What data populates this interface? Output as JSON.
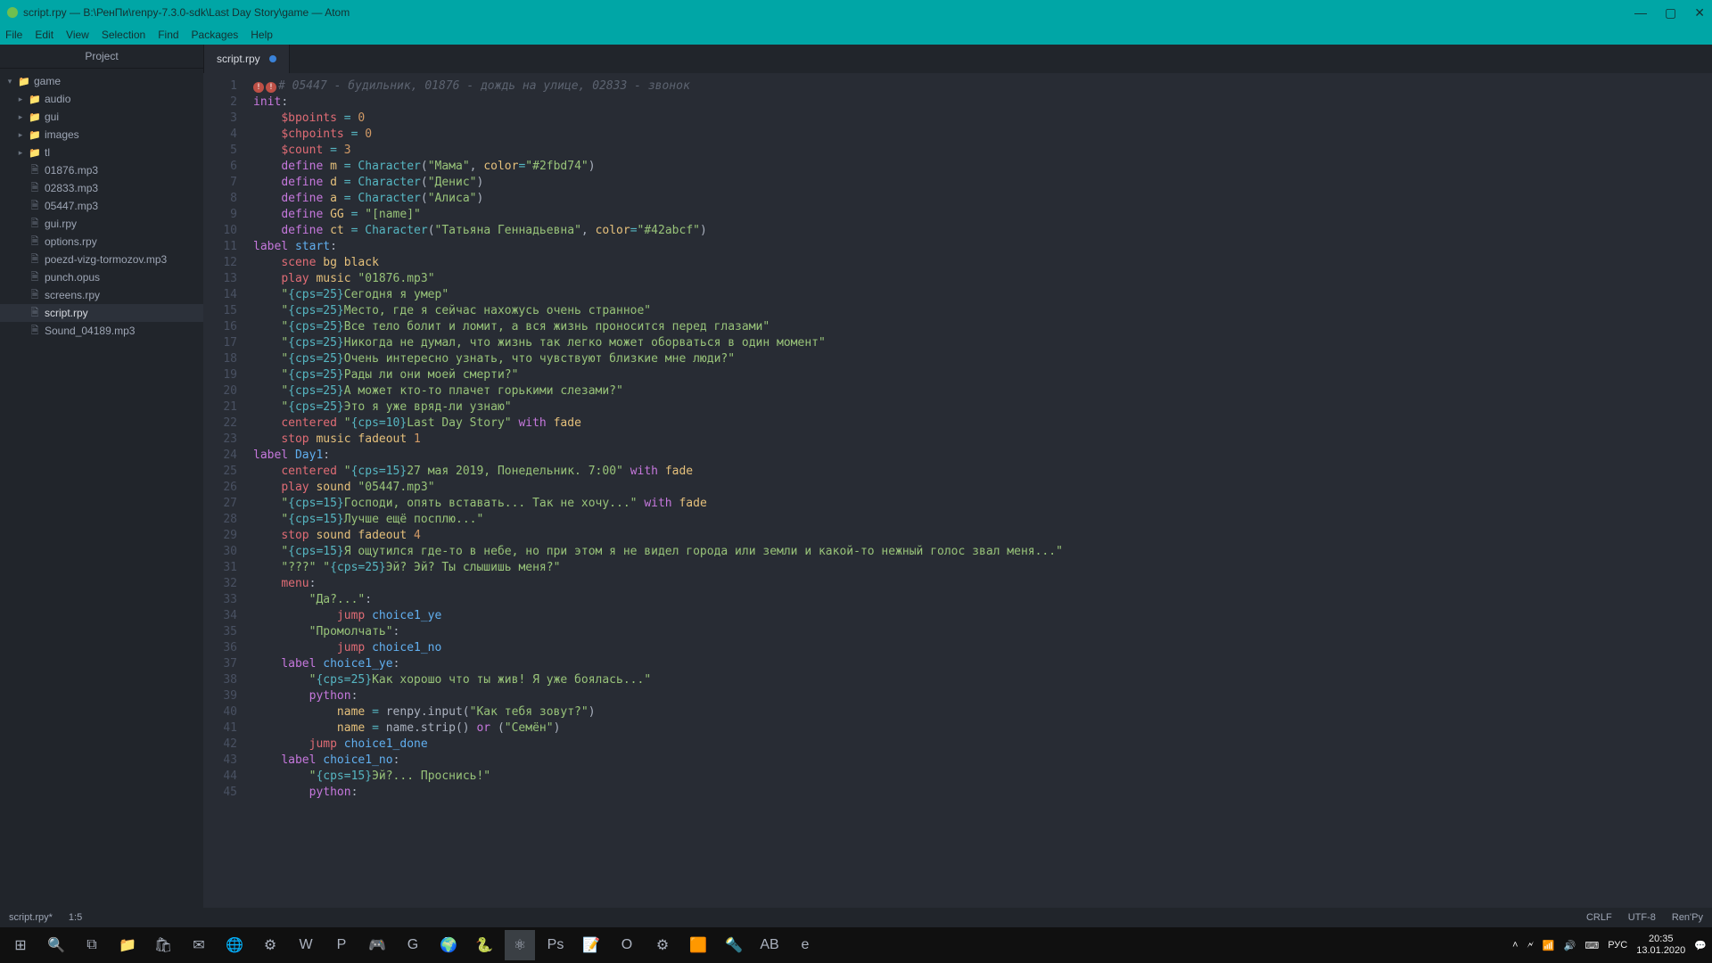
{
  "window": {
    "title": "script.rpy — B:\\РенПи\\renpy-7.3.0-sdk\\Last Day Story\\game — Atom",
    "min": "—",
    "max": "▢",
    "close": "✕"
  },
  "menubar": [
    "File",
    "Edit",
    "View",
    "Selection",
    "Find",
    "Packages",
    "Help"
  ],
  "sidebar": {
    "header": "Project",
    "root": "game",
    "folders": [
      "audio",
      "gui",
      "images",
      "tl"
    ],
    "files": [
      "01876.mp3",
      "02833.mp3",
      "05447.mp3",
      "gui.rpy",
      "options.rpy",
      "poezd-vizg-tormozov.mp3",
      "punch.opus",
      "screens.rpy",
      "script.rpy",
      "Sound_04189.mp3"
    ],
    "selected": "script.rpy"
  },
  "tab": {
    "label": "script.rpy"
  },
  "status": {
    "file": "script.rpy*",
    "pos": "1:5",
    "eol": "CRLF",
    "enc": "UTF-8",
    "lang": "Ren'Py"
  },
  "clock": {
    "time": "20:35",
    "date": "13.01.2020",
    "lang": "РУС"
  },
  "code": {
    "lines": [
      {
        "n": 1,
        "html": "<span class='err'>!</span><span class='err'>!</span><span class='cm'># 05447 - будильник, 01876 - дождь на улице, 02833 - звонок</span>"
      },
      {
        "n": 2,
        "html": "<span class='kw'>init</span>:"
      },
      {
        "n": 3,
        "html": "    <span class='var'>$bpoints</span> <span class='op'>=</span> <span class='num'>0</span>"
      },
      {
        "n": 4,
        "html": "    <span class='var'>$chpoints</span> <span class='op'>=</span> <span class='num'>0</span>"
      },
      {
        "n": 5,
        "html": "    <span class='var'>$count</span> <span class='op'>=</span> <span class='num'>3</span>"
      },
      {
        "n": 6,
        "html": "    <span class='kw'>define</span> <span class='id'>m</span> <span class='op'>=</span> <span class='fn'>Character</span>(<span class='str'>\"Мама\"</span>, <span class='id'>color</span><span class='op'>=</span><span class='str'>\"#2fbd74\"</span>)"
      },
      {
        "n": 7,
        "html": "    <span class='kw'>define</span> <span class='id'>d</span> <span class='op'>=</span> <span class='fn'>Character</span>(<span class='str'>\"Денис\"</span>)"
      },
      {
        "n": 8,
        "html": "    <span class='kw'>define</span> <span class='id'>a</span> <span class='op'>=</span> <span class='fn'>Character</span>(<span class='str'>\"Алиса\"</span>)"
      },
      {
        "n": 9,
        "html": "    <span class='kw'>define</span> <span class='id'>GG</span> <span class='op'>=</span> <span class='str'>\"[name]\"</span>"
      },
      {
        "n": 10,
        "html": "    <span class='kw'>define</span> <span class='id'>ct</span> <span class='op'>=</span> <span class='fn'>Character</span>(<span class='str'>\"Татьяна Геннадьевна\"</span>, <span class='id'>color</span><span class='op'>=</span><span class='str'>\"#42abcf\"</span>)"
      },
      {
        "n": 11,
        "html": "<span class='kw'>label</span> <span class='lbl'>start</span>:"
      },
      {
        "n": 12,
        "html": "    <span class='kw2'>scene</span> <span class='id'>bg</span> <span class='id'>black</span>"
      },
      {
        "n": 13,
        "html": "    <span class='kw2'>play</span> <span class='id'>music</span> <span class='str'>\"01876.mp3\"</span>"
      },
      {
        "n": 14,
        "html": "    <span class='str'>\"<span class='esc'>{cps=25}</span>Сегодня я умер\"</span>"
      },
      {
        "n": 15,
        "html": "    <span class='str'>\"<span class='esc'>{cps=25}</span>Место, где я сейчас нахожусь очень странное\"</span>"
      },
      {
        "n": 16,
        "html": "    <span class='str'>\"<span class='esc'>{cps=25}</span>Все тело болит и ломит, а вся жизнь проносится перед глазами\"</span>"
      },
      {
        "n": 17,
        "html": "    <span class='str'>\"<span class='esc'>{cps=25}</span>Никогда не думал, что жизнь так легко может оборваться в один момент\"</span>"
      },
      {
        "n": 18,
        "html": "    <span class='str'>\"<span class='esc'>{cps=25}</span>Очень интересно узнать, что чувствуют близкие мне люди?\"</span>"
      },
      {
        "n": 19,
        "html": "    <span class='str'>\"<span class='esc'>{cps=25}</span>Рады ли они моей смерти?\"</span>"
      },
      {
        "n": 20,
        "html": "    <span class='str'>\"<span class='esc'>{cps=25}</span>А может кто-то плачет горькими слезами?\"</span>"
      },
      {
        "n": 21,
        "html": "    <span class='str'>\"<span class='esc'>{cps=25}</span>Это я уже вряд-ли узнаю\"</span>"
      },
      {
        "n": 22,
        "html": "    <span class='kw2'>centered</span> <span class='str'>\"<span class='esc'>{cps=10}</span>Last Day Story\"</span> <span class='kw'>with</span> <span class='id'>fade</span>"
      },
      {
        "n": 23,
        "html": "    <span class='kw2'>stop</span> <span class='id'>music</span> <span class='id'>fadeout</span> <span class='num'>1</span>"
      },
      {
        "n": 24,
        "html": "<span class='kw'>label</span> <span class='lbl'>Day1</span>:"
      },
      {
        "n": 25,
        "html": "    <span class='kw2'>centered</span> <span class='str'>\"<span class='esc'>{cps=15}</span>27 мая 2019, Понедельник. 7:00\"</span> <span class='kw'>with</span> <span class='id'>fade</span>"
      },
      {
        "n": 26,
        "html": "    <span class='kw2'>play</span> <span class='id'>sound</span> <span class='str'>\"05447.mp3\"</span>"
      },
      {
        "n": 27,
        "html": "    <span class='str'>\"<span class='esc'>{cps=15}</span>Господи, опять вставать... Так не хочу...\"</span> <span class='kw'>with</span> <span class='id'>fade</span>"
      },
      {
        "n": 28,
        "html": "    <span class='str'>\"<span class='esc'>{cps=15}</span>Лучше ещё посплю...\"</span>"
      },
      {
        "n": 29,
        "html": "    <span class='kw2'>stop</span> <span class='id'>sound</span> <span class='id'>fadeout</span> <span class='num'>4</span>"
      },
      {
        "n": 30,
        "html": "    <span class='str'>\"<span class='esc'>{cps=15}</span>Я ощутился где-то в небе, но при этом я не видел города или земли и какой-то нежный голос звал меня...\"</span>"
      },
      {
        "n": 31,
        "html": "    <span class='str'>\"???\"</span> <span class='str'>\"<span class='esc'>{cps=25}</span>Эй? Эй? Ты слышишь меня?\"</span>"
      },
      {
        "n": 32,
        "html": "    <span class='kw2'>menu</span>:"
      },
      {
        "n": 33,
        "html": "        <span class='str'>\"Да?...\"</span>:"
      },
      {
        "n": 34,
        "html": "            <span class='kw2'>jump</span> <span class='lbl'>choice1_ye</span>"
      },
      {
        "n": 35,
        "html": "        <span class='str'>\"Промолчать\"</span>:"
      },
      {
        "n": 36,
        "html": "            <span class='kw2'>jump</span> <span class='lbl'>choice1_no</span>"
      },
      {
        "n": 37,
        "html": "    <span class='kw'>label</span> <span class='lbl'>choice1_ye</span>:"
      },
      {
        "n": 38,
        "html": "        <span class='str'>\"<span class='esc'>{cps=25}</span>Как хорошо что ты жив! Я уже боялась...\"</span>"
      },
      {
        "n": 39,
        "html": "        <span class='py'>python</span>:"
      },
      {
        "n": 40,
        "html": "            <span class='id'>name</span> <span class='op'>=</span> renpy.input(<span class='str'>\"Как тебя зовут?\"</span>)"
      },
      {
        "n": 41,
        "html": "            <span class='id'>name</span> <span class='op'>=</span> name.strip() <span class='kw'>or</span> (<span class='str'>\"Семён\"</span>)"
      },
      {
        "n": 42,
        "html": "        <span class='kw2'>jump</span> <span class='lbl'>choice1_done</span>"
      },
      {
        "n": 43,
        "html": "    <span class='kw'>label</span> <span class='lbl'>choice1_no</span>:"
      },
      {
        "n": 44,
        "html": "        <span class='str'>\"<span class='esc'>{cps=15}</span>Эй?... Проснись!\"</span>"
      },
      {
        "n": 45,
        "html": "        <span class='py'>python</span>:"
      }
    ]
  },
  "taskbar_apps": [
    "win",
    "search",
    "taskview",
    "explorer",
    "store",
    "mail",
    "chrome",
    "steam",
    "word",
    "powerpoint",
    "discord",
    "grammarly",
    "globe",
    "renpy",
    "atom",
    "photoshop",
    "notes",
    "opera",
    "settings",
    "sublime",
    "torch",
    "abnet",
    "edge"
  ]
}
